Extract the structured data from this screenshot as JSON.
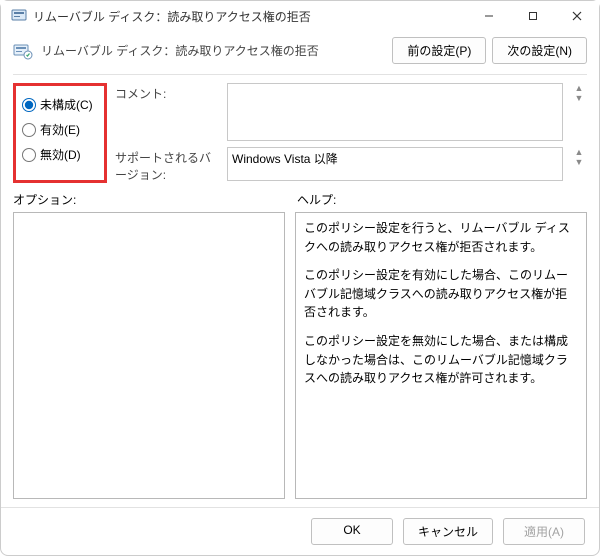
{
  "titlebar": {
    "title": "リムーバブル ディスク：読み取りアクセス権の拒否"
  },
  "header": {
    "subtitle": "リムーバブル ディスク：読み取りアクセス権の拒否",
    "prev_label": "前の設定(P)",
    "next_label": "次の設定(N)"
  },
  "radios": {
    "not_configured": "未構成(C)",
    "enabled": "有効(E)",
    "disabled": "無効(D)"
  },
  "fields": {
    "comment_label": "コメント:",
    "supported_label": "サポートされるバージョン:",
    "supported_value": "Windows Vista 以降"
  },
  "sections": {
    "options_label": "オプション:",
    "help_label": "ヘルプ:"
  },
  "help": {
    "p1": "このポリシー設定を行うと、リムーバブル ディスクへの読み取りアクセス権が拒否されます。",
    "p2": "このポリシー設定を有効にした場合、このリムーバブル記憶域クラスへの読み取りアクセス権が拒否されます。",
    "p3": "このポリシー設定を無効にした場合、または構成しなかった場合は、このリムーバブル記憶域クラスへの読み取りアクセス権が許可されます。"
  },
  "footer": {
    "ok": "OK",
    "cancel": "キャンセル",
    "apply": "適用(A)"
  }
}
